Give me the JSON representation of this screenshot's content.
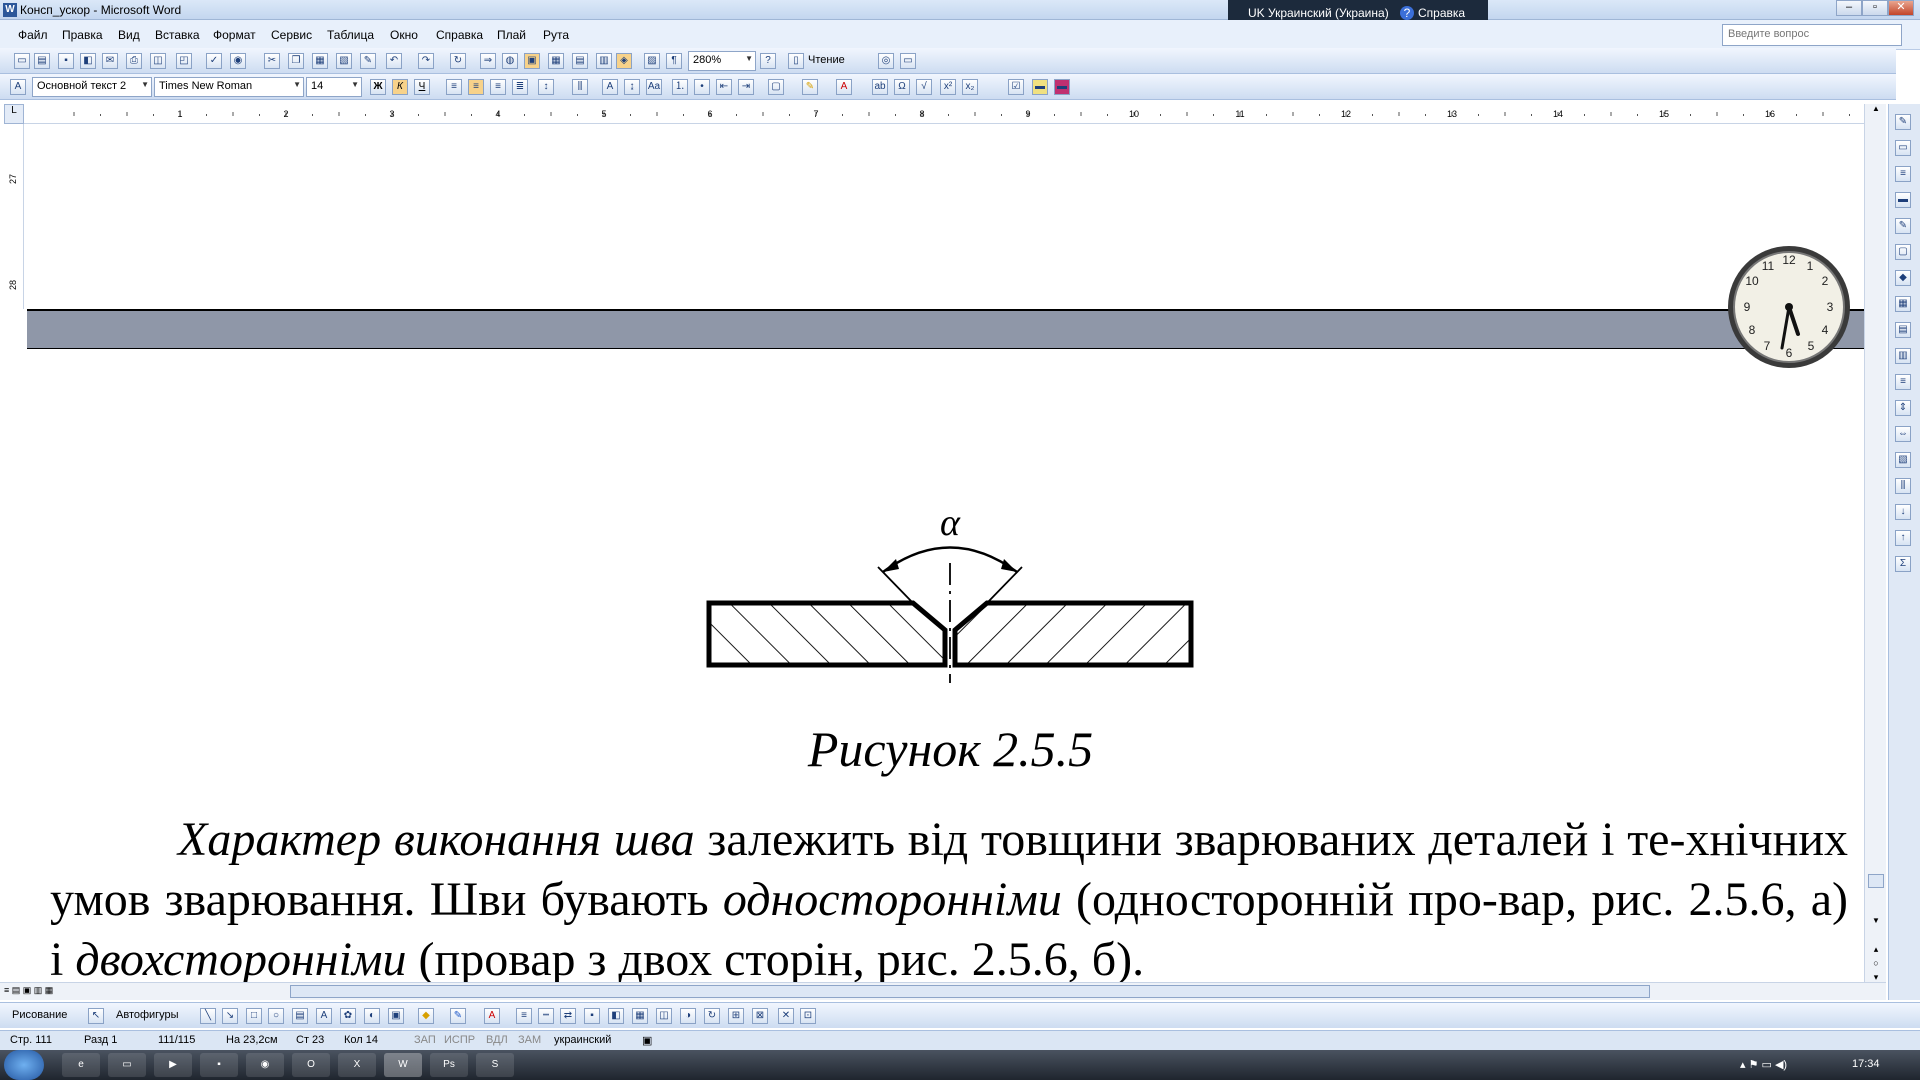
{
  "window": {
    "title": "Консп_ускор - Microsoft Word",
    "lang_indicator": "UK Украинский (Украина)",
    "help_label": "Справка"
  },
  "menu": {
    "items": [
      "Файл",
      "Правка",
      "Вид",
      "Вставка",
      "Формат",
      "Сервис",
      "Таблица",
      "Окно",
      "Справка",
      "Плай",
      "Рута"
    ],
    "ask_placeholder": "Введите вопрос"
  },
  "toolbar": {
    "zoom": "280%",
    "read_label": "Чтение",
    "style": "Основной текст 2",
    "font": "Times New Roman",
    "size": "14",
    "bold": "Ж",
    "italic": "К",
    "underline": "Ч"
  },
  "ruler": {
    "numbers": [
      "1",
      "2",
      "3",
      "4",
      "5",
      "6",
      "7",
      "8",
      "9",
      "10",
      "11",
      "12",
      "13",
      "14",
      "15",
      "16"
    ],
    "vertical": [
      "27",
      "28"
    ]
  },
  "figure": {
    "angle_label": "α",
    "caption": "Рисунок 2.5.5"
  },
  "paragraph": {
    "p1_italic": "Характер виконання шва",
    "p1_rest": " залежить від товщини зварюваних деталей і те-хнічних умов зварювання. Шви бувають ",
    "p2_italic": "односторонніми",
    "p2_rest": " (односторонній про-вар, рис. 2.5.6, а) і ",
    "p3_italic": "двохсторонніми",
    "p3_rest": " (провар з двох сторін, рис. 2.5.6, б)."
  },
  "drawing_toolbar": {
    "draw_label": "Рисование",
    "autoshapes_label": "Автофигуры"
  },
  "status": {
    "page": "Стр. 111",
    "section": "Разд 1",
    "pages": "111/115",
    "at": "На 23,2см",
    "line": "Ст 23",
    "col": "Кол 14",
    "rec": "ЗАП",
    "trk": "ИСПР",
    "ext": "ВДЛ",
    "ovr": "ЗАМ",
    "language": "украинский"
  },
  "taskbar": {
    "time": "17:34"
  }
}
